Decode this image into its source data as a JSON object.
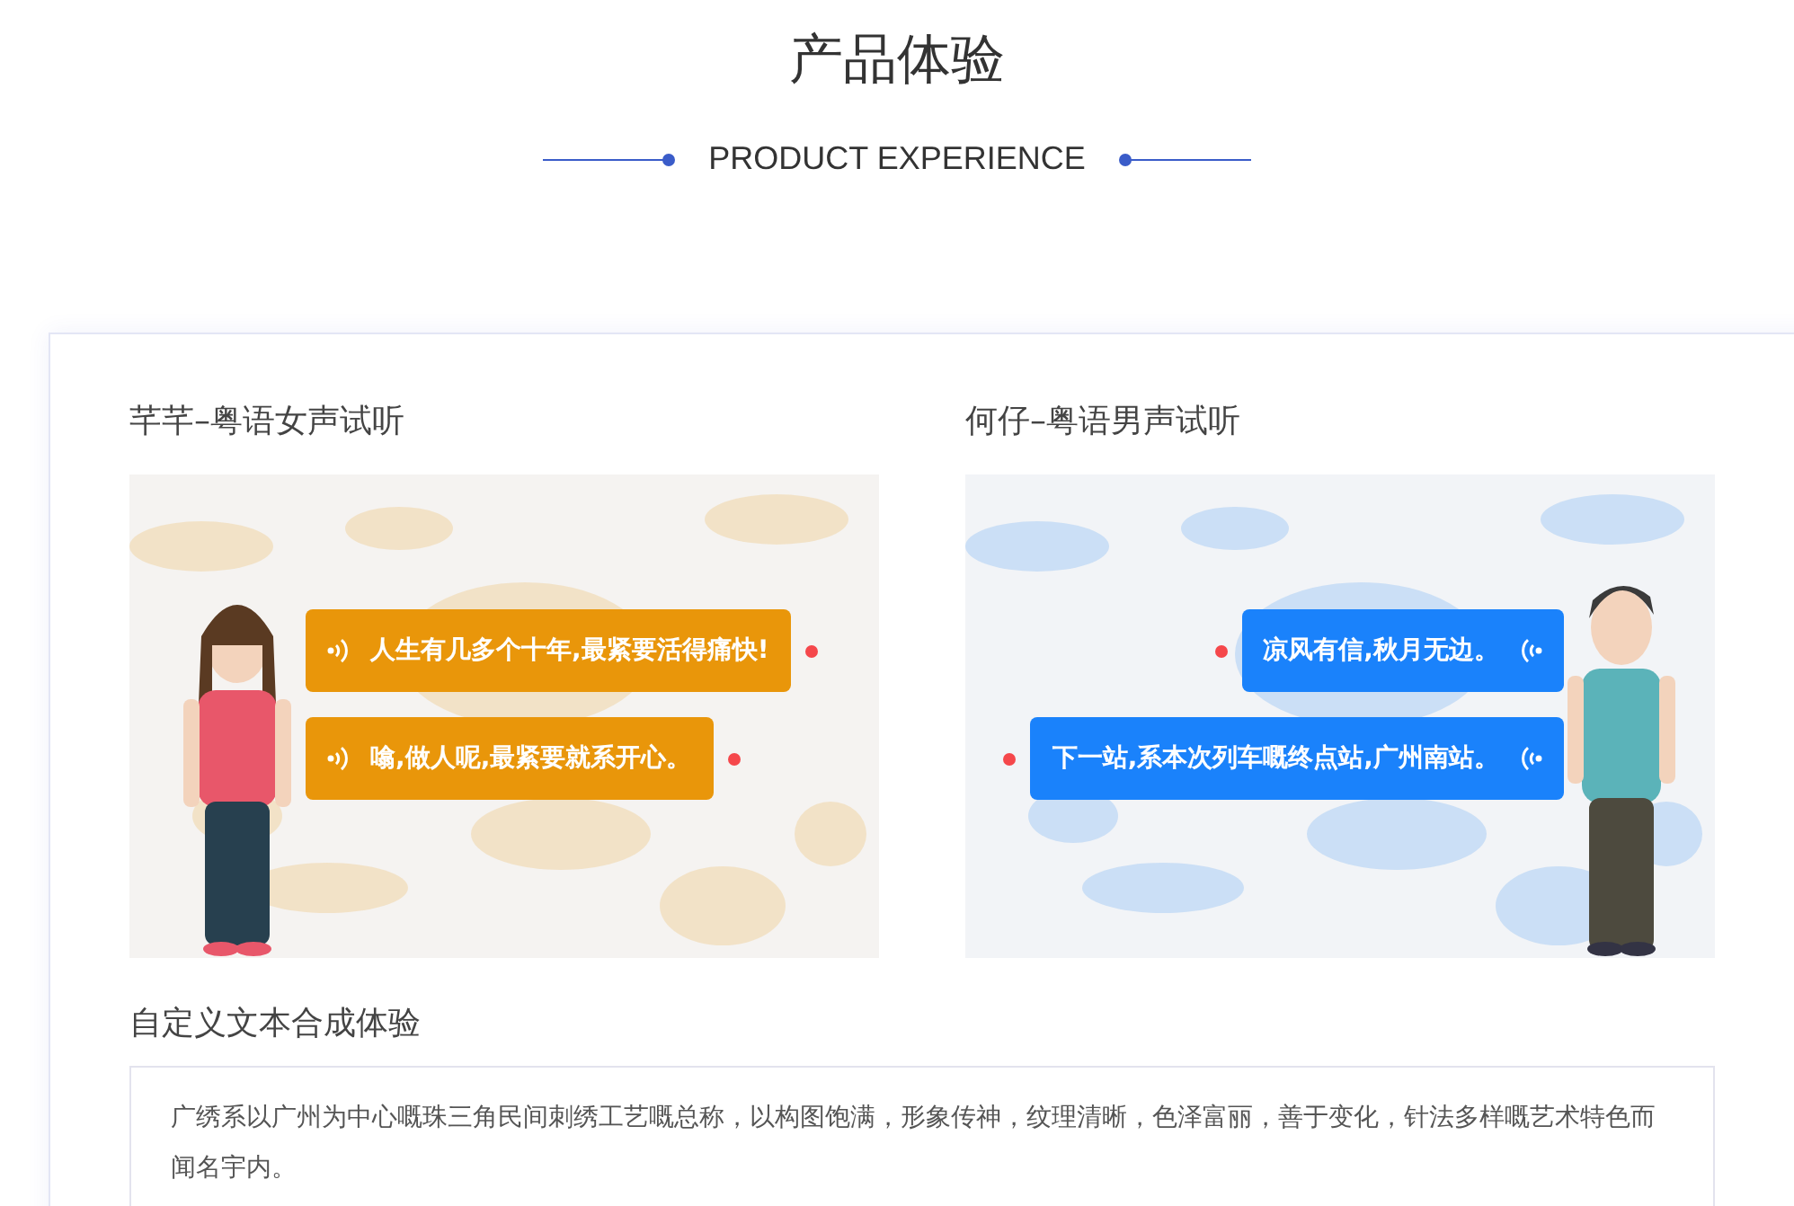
{
  "header": {
    "title": "产品体验",
    "subtitle": "PRODUCT EXPERIENCE"
  },
  "samples": [
    {
      "title": "芊芊–粤语女声试听",
      "kind": "female",
      "bubbles": [
        {
          "text": "人生有几多个十年,最紧要活得痛快!"
        },
        {
          "text": "噏,做人呢,最紧要就系开心。"
        }
      ]
    },
    {
      "title": "何仔–粤语男声试听",
      "kind": "male",
      "bubbles": [
        {
          "text": "凉风有信,秋月无边。"
        },
        {
          "text": "下一站,系本次列车嘅终点站,广州南站。"
        }
      ]
    }
  ],
  "custom": {
    "title": "自定义文本合成体验",
    "value": "广绣系以广州为中心嘅珠三角民间刺绣工艺嘅总称，以构图饱满，形象传神，纹理清晰，色泽富丽，善于变化，针法多样嘅艺术特色而闻名宇内。"
  }
}
